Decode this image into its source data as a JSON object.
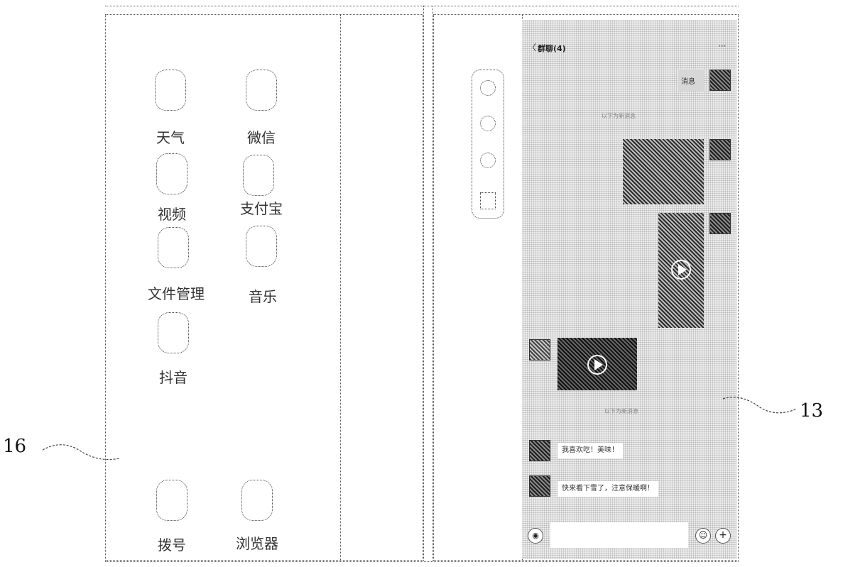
{
  "left_screen": {
    "apps": [
      {
        "name": "天气"
      },
      {
        "name": "微信"
      },
      {
        "name": "视频"
      },
      {
        "name": "支付宝"
      },
      {
        "name": "文件管理"
      },
      {
        "name": "音乐"
      },
      {
        "name": "抖音"
      },
      {
        "name": "拨号"
      },
      {
        "name": "浏览器"
      }
    ]
  },
  "chat": {
    "title": "群聊(4)",
    "back_symbol": "〈",
    "more_symbol": "···",
    "sent_text": "消息",
    "system_notice_1": "以下为新消息",
    "system_notice_2": "以下为新消息",
    "messages": [
      {
        "text": "我喜欢吃！美味！"
      },
      {
        "text": "快来看下雪了，注意保暖啊！"
      }
    ],
    "input": {
      "voice_symbol": "◉",
      "emoji_symbol": "☺",
      "plus_symbol": "+"
    }
  },
  "labels": {
    "left_ref": "16",
    "right_ref": "13"
  }
}
